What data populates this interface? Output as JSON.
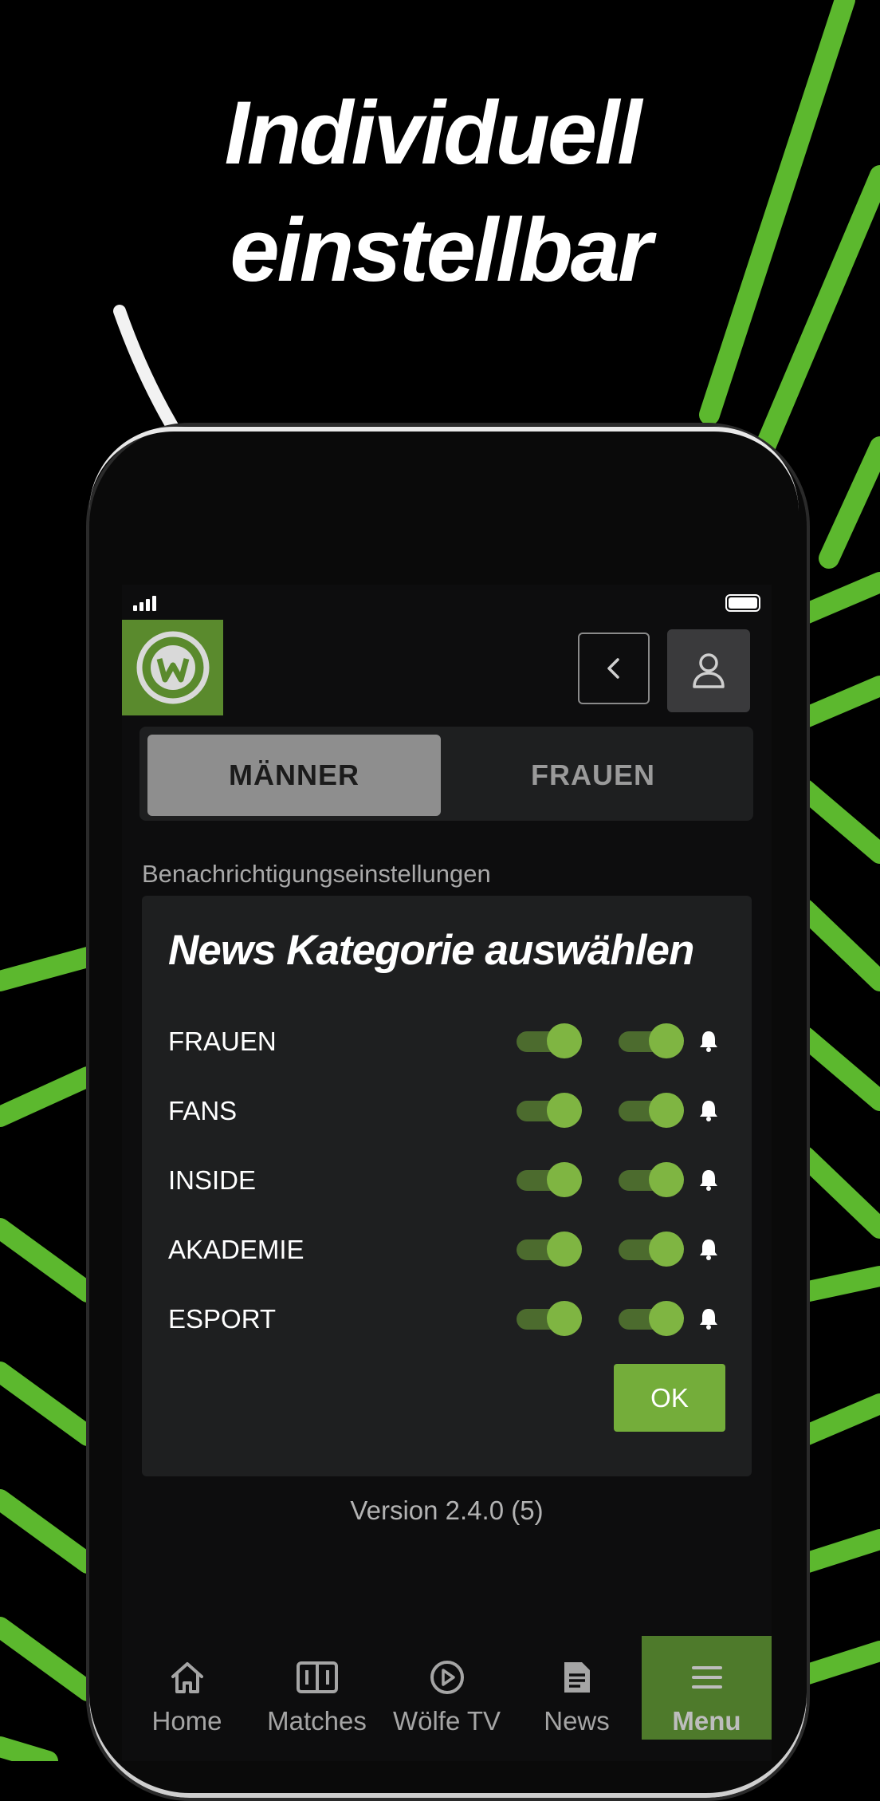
{
  "promo": {
    "headline_line1": "Individuell",
    "headline_line2": "einstellbar",
    "accent_color": "#5cb82e"
  },
  "status_bar": {
    "signal": "signal-icon",
    "battery": "battery-icon"
  },
  "header": {
    "logo": "vfl-wolfsburg-logo",
    "back_icon": "chevron-left-icon",
    "user_icon": "user-icon"
  },
  "segment": {
    "options": [
      "MÄNNER",
      "FRAUEN"
    ],
    "selected": "MÄNNER"
  },
  "settings": {
    "section_label": "Benachrichtigungseinstellungen",
    "card_title": "News Kategorie auswählen",
    "categories": [
      {
        "label": "FRAUEN",
        "toggle1": true,
        "toggle2": true
      },
      {
        "label": "FANS",
        "toggle1": true,
        "toggle2": true
      },
      {
        "label": "INSIDE",
        "toggle1": true,
        "toggle2": true
      },
      {
        "label": "AKADEMIE",
        "toggle1": true,
        "toggle2": true
      },
      {
        "label": "ESPORT",
        "toggle1": true,
        "toggle2": true
      }
    ],
    "ok_label": "OK"
  },
  "version": "Version 2.4.0 (5)",
  "tabbar": {
    "items": [
      {
        "label": "Home",
        "icon": "home-icon"
      },
      {
        "label": "Matches",
        "icon": "scoreboard-icon"
      },
      {
        "label": "Wölfe TV",
        "icon": "play-circle-icon"
      },
      {
        "label": "News",
        "icon": "document-icon"
      },
      {
        "label": "Menu",
        "icon": "menu-icon"
      }
    ],
    "active": "Menu"
  }
}
